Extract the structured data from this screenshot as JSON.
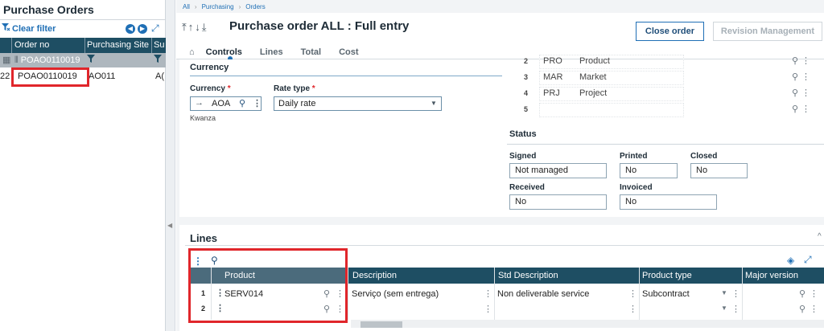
{
  "left_panel": {
    "title": "Purchase Orders",
    "clear_filter": "Clear filter",
    "columns": [
      "Order no",
      "Purchasing Site",
      "Su"
    ],
    "filter_row": {
      "order_no": "POAO0110019"
    },
    "rows": [
      {
        "prefix": "22",
        "order_no": "POAO0110019",
        "site": "AO011",
        "su": "A("
      }
    ]
  },
  "breadcrumb": [
    "All",
    "Purchasing",
    "Orders"
  ],
  "header": {
    "title": "Purchase order ALL : Full entry",
    "close_order": "Close order",
    "revision_management": "Revision Management"
  },
  "tabs": [
    "Controls",
    "Lines",
    "Total",
    "Cost"
  ],
  "active_tab": "Controls",
  "currency_section": {
    "title": "Currency",
    "currency_label": "Currency",
    "currency_value": "AOA",
    "currency_name": "Kwanza",
    "rate_type_label": "Rate type",
    "rate_type_value": "Daily rate",
    "required_mark": "*"
  },
  "dimensions": [
    {
      "num": "2",
      "code": "PRO",
      "desc": "Product"
    },
    {
      "num": "3",
      "code": "MAR",
      "desc": "Market"
    },
    {
      "num": "4",
      "code": "PRJ",
      "desc": "Project"
    },
    {
      "num": "5",
      "code": "",
      "desc": ""
    }
  ],
  "status": {
    "title": "Status",
    "signed_label": "Signed",
    "signed_value": "Not managed",
    "printed_label": "Printed",
    "printed_value": "No",
    "closed_label": "Closed",
    "closed_value": "No",
    "received_label": "Received",
    "received_value": "No",
    "invoiced_label": "Invoiced",
    "invoiced_value": "No"
  },
  "lines": {
    "title": "Lines",
    "columns": [
      "Product",
      "Description",
      "Std Description",
      "Product type",
      "Major version"
    ],
    "rows": [
      {
        "num": "1",
        "product": "SERV014",
        "description": "Serviço (sem entrega)",
        "std_description": "Non deliverable service",
        "product_type": "Subcontract",
        "major_version": ""
      },
      {
        "num": "2",
        "product": "",
        "description": "",
        "std_description": "",
        "product_type": "",
        "major_version": ""
      }
    ]
  },
  "colors": {
    "grid_header": "#1e4e63",
    "accent": "#1f6fb5",
    "highlight": "#e0262b"
  }
}
